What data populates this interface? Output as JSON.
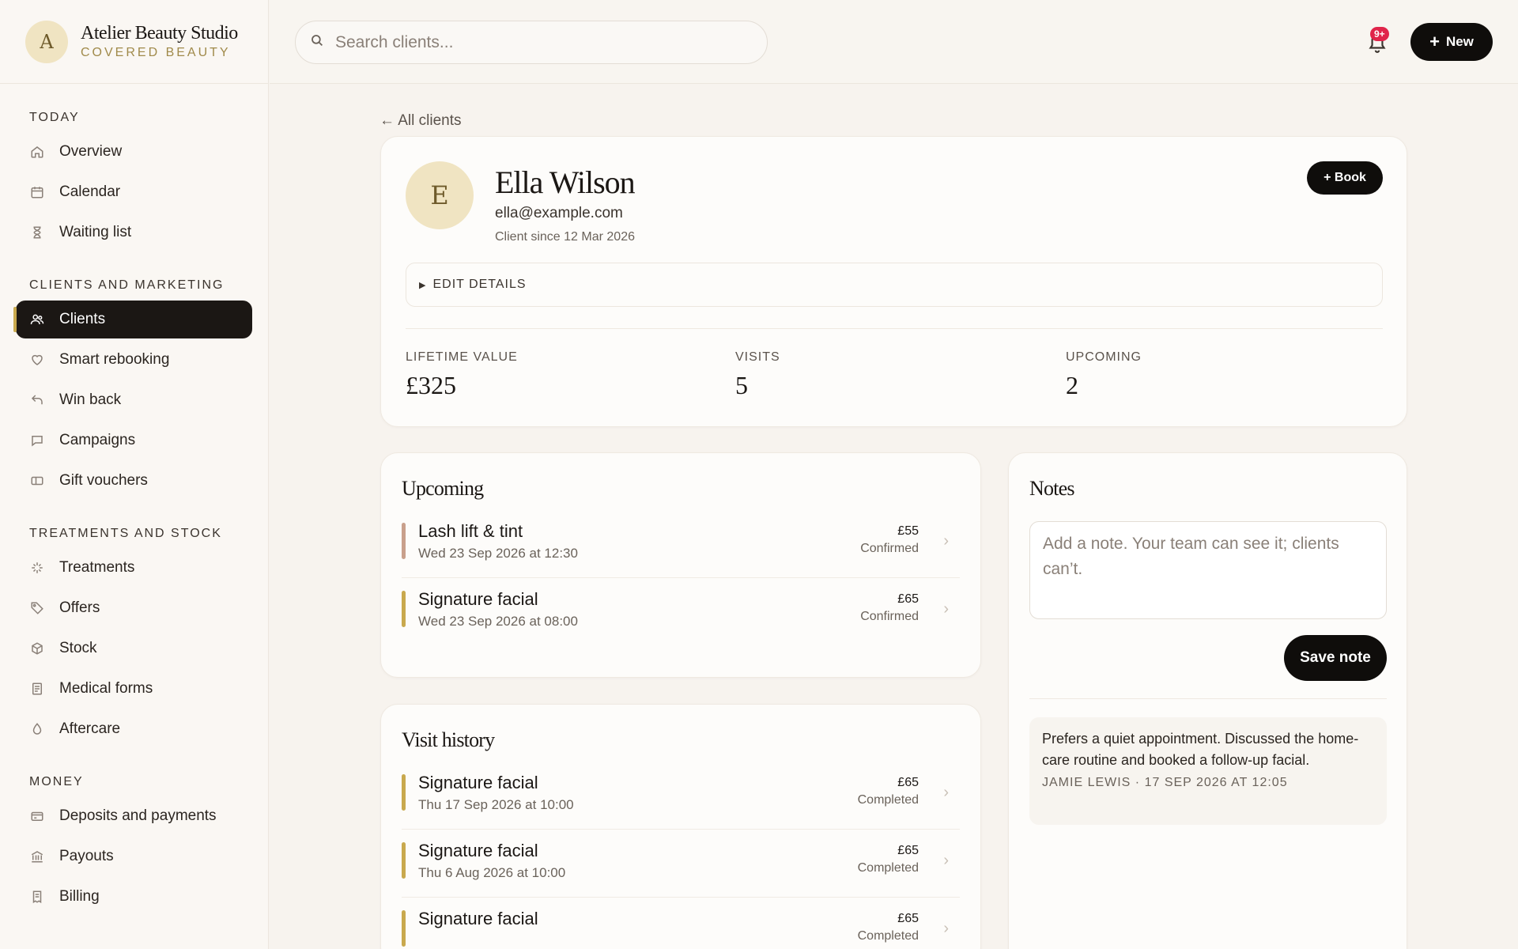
{
  "brand": {
    "initial": "A",
    "name": "Atelier Beauty Studio",
    "tagline": "COVERED BEAUTY"
  },
  "sidebar": {
    "sections": [
      {
        "heading": "TODAY",
        "items": [
          {
            "label": "Overview",
            "icon": "home-icon"
          },
          {
            "label": "Calendar",
            "icon": "calendar-icon"
          },
          {
            "label": "Waiting list",
            "icon": "hourglass-icon"
          }
        ]
      },
      {
        "heading": "CLIENTS AND MARKETING",
        "items": [
          {
            "label": "Clients",
            "icon": "users-icon",
            "active": true
          },
          {
            "label": "Smart rebooking",
            "icon": "heart-icon"
          },
          {
            "label": "Win back",
            "icon": "return-icon"
          },
          {
            "label": "Campaigns",
            "icon": "chat-icon"
          },
          {
            "label": "Gift vouchers",
            "icon": "ticket-icon"
          }
        ]
      },
      {
        "heading": "TREATMENTS AND STOCK",
        "items": [
          {
            "label": "Treatments",
            "icon": "sparkle-icon"
          },
          {
            "label": "Offers",
            "icon": "tag-icon"
          },
          {
            "label": "Stock",
            "icon": "box-icon"
          },
          {
            "label": "Medical forms",
            "icon": "document-icon"
          },
          {
            "label": "Aftercare",
            "icon": "droplet-icon"
          }
        ]
      },
      {
        "heading": "MONEY",
        "items": [
          {
            "label": "Deposits and payments",
            "icon": "card-icon"
          },
          {
            "label": "Payouts",
            "icon": "bank-icon"
          },
          {
            "label": "Billing",
            "icon": "receipt-icon"
          }
        ]
      }
    ]
  },
  "header": {
    "search_placeholder": "Search clients...",
    "notification_badge": "9+",
    "new_label": "New"
  },
  "back_link": "← All clients",
  "client": {
    "initial": "E",
    "name": "Ella Wilson",
    "email": "ella@example.com",
    "since": "Client since 12 Mar 2026",
    "book_label": "+ Book",
    "edit_label": "EDIT DETAILS",
    "stats": [
      {
        "label": "LIFETIME VALUE",
        "value": "£325"
      },
      {
        "label": "VISITS",
        "value": "5"
      },
      {
        "label": "UPCOMING",
        "value": "2"
      }
    ]
  },
  "upcoming": {
    "title": "Upcoming",
    "items": [
      {
        "title": "Lash lift & tint",
        "when": "Wed 23 Sep 2026 at 12:30",
        "price": "£55",
        "status": "Confirmed",
        "color": "#c9a08c"
      },
      {
        "title": "Signature facial",
        "when": "Wed 23 Sep 2026 at 08:00",
        "price": "£65",
        "status": "Confirmed",
        "color": "#c9a94e"
      }
    ]
  },
  "history": {
    "title": "Visit history",
    "items": [
      {
        "title": "Signature facial",
        "when": "Thu 17 Sep 2026 at 10:00",
        "price": "£65",
        "status": "Completed",
        "color": "#c9a94e"
      },
      {
        "title": "Signature facial",
        "when": "Thu 6 Aug 2026 at 10:00",
        "price": "£65",
        "status": "Completed",
        "color": "#c9a94e"
      },
      {
        "title": "Signature facial",
        "when": "",
        "price": "£65",
        "status": "Completed",
        "color": "#c9a94e"
      }
    ]
  },
  "notes": {
    "title": "Notes",
    "placeholder": "Add a note. Your team can see it; clients can’t.",
    "save_label": "Save note",
    "items": [
      {
        "text": "Prefers a quiet appointment. Discussed the home-care routine and booked a follow-up facial.",
        "meta": "JAMIE LEWIS · 17 SEP 2026 AT 12:05"
      }
    ]
  }
}
